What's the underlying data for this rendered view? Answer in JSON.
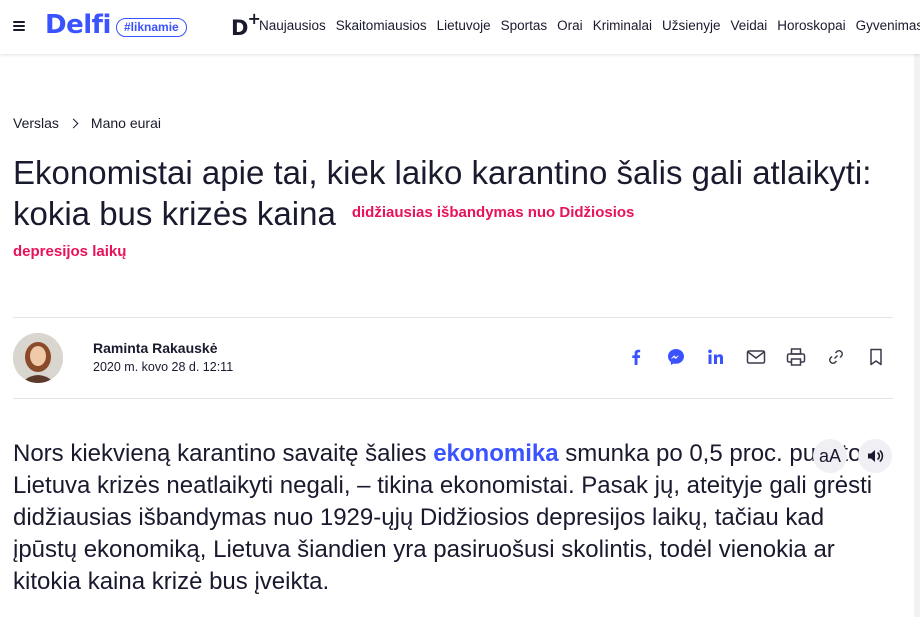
{
  "header": {
    "logo": "Delfi",
    "tag": "#liknamie",
    "dplus": "D",
    "dplus_sup": "+",
    "nav": [
      "Naujausios",
      "Skaitomiausios",
      "Lietuvoje",
      "Sportas",
      "Orai",
      "Kriminalai",
      "Užsienyje",
      "Veidai",
      "Horoskopai",
      "Gyvenimas"
    ]
  },
  "breadcrumb": [
    "Verslas",
    "Mano eurai"
  ],
  "article": {
    "title": "Ekonomistai apie tai, kiek laiko karantino šalis gali atlaikyti: kokia bus krizės kaina",
    "subtitle_part1": "didžiausias išbandymas nuo Didžiosios",
    "subtitle_part2": "depresijos laikų",
    "author": "Raminta Rakauskė",
    "date": "2020 m. kovo 28 d. 12:11",
    "lead_before_link": "Nors kiekvieną karantino savaitę šalies ",
    "lead_link": "ekonomika",
    "lead_after_link": " smunka po 0,5 proc. punkto, Lietuva krizės neatlaikyti negali, – tikina ekonomistai. Pasak jų, ateityje gali grėsti didžiausias išbandymas nuo 1929-ųjų Didžiosios depresijos laikų, tačiau kad įpūstų ekonomiką, Lietuva šiandien yra pasiruošusi skolintis, todėl vienokia ar kitokia kaina krizė bus įveikta."
  },
  "controls": {
    "font_size_label": "aA"
  },
  "share_icons": [
    "facebook-icon",
    "messenger-icon",
    "linkedin-icon",
    "email-icon",
    "print-icon",
    "link-icon",
    "bookmark-icon"
  ],
  "colors": {
    "brand": "#3a53ff",
    "accent": "#e8115b",
    "text": "#1a1a2e"
  }
}
